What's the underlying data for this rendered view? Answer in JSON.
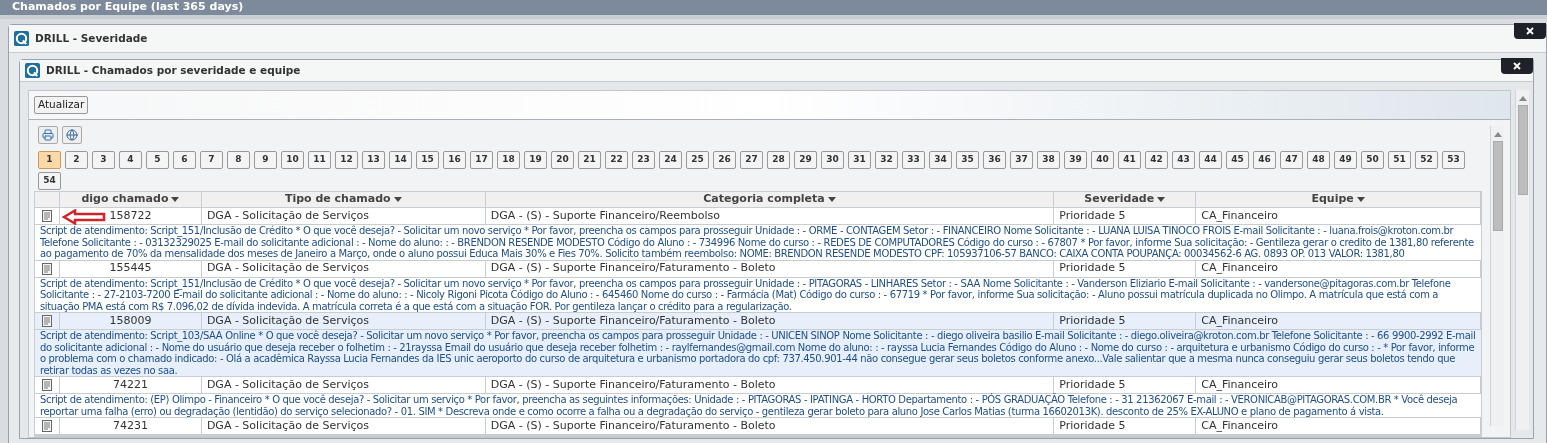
{
  "dashboard": {
    "title": "Chamados por Equipe (last 365 days)"
  },
  "drill_window": {
    "title": "DRILL - Severidade"
  },
  "inner_window": {
    "title": "DRILL - Chamados por severidade e equipe",
    "refresh_button": "Atualizar",
    "pages": [
      {
        "label": "1",
        "selected": true
      },
      {
        "label": "2",
        "selected": false
      },
      {
        "label": "3",
        "selected": false
      },
      {
        "label": "4",
        "selected": false
      },
      {
        "label": "5",
        "selected": false
      },
      {
        "label": "6",
        "selected": false
      },
      {
        "label": "7",
        "selected": false
      },
      {
        "label": "8",
        "selected": false
      },
      {
        "label": "9",
        "selected": false
      },
      {
        "label": "10",
        "selected": false
      },
      {
        "label": "11",
        "selected": false
      },
      {
        "label": "12",
        "selected": false
      },
      {
        "label": "13",
        "selected": false
      },
      {
        "label": "14",
        "selected": false
      },
      {
        "label": "15",
        "selected": false
      },
      {
        "label": "16",
        "selected": false
      },
      {
        "label": "17",
        "selected": false
      },
      {
        "label": "18",
        "selected": false
      },
      {
        "label": "19",
        "selected": false
      },
      {
        "label": "20",
        "selected": false
      },
      {
        "label": "21",
        "selected": false
      },
      {
        "label": "22",
        "selected": false
      },
      {
        "label": "23",
        "selected": false
      },
      {
        "label": "24",
        "selected": false
      },
      {
        "label": "25",
        "selected": false
      },
      {
        "label": "26",
        "selected": false
      },
      {
        "label": "27",
        "selected": false
      },
      {
        "label": "28",
        "selected": false
      },
      {
        "label": "29",
        "selected": false
      },
      {
        "label": "30",
        "selected": false
      },
      {
        "label": "31",
        "selected": false
      },
      {
        "label": "32",
        "selected": false
      },
      {
        "label": "33",
        "selected": false
      },
      {
        "label": "34",
        "selected": false
      },
      {
        "label": "35",
        "selected": false
      },
      {
        "label": "36",
        "selected": false
      },
      {
        "label": "37",
        "selected": false
      },
      {
        "label": "38",
        "selected": false
      },
      {
        "label": "39",
        "selected": false
      },
      {
        "label": "40",
        "selected": false
      },
      {
        "label": "41",
        "selected": false
      },
      {
        "label": "42",
        "selected": false
      },
      {
        "label": "43",
        "selected": false
      },
      {
        "label": "44",
        "selected": false
      },
      {
        "label": "45",
        "selected": false
      },
      {
        "label": "46",
        "selected": false
      },
      {
        "label": "47",
        "selected": false
      },
      {
        "label": "48",
        "selected": false
      },
      {
        "label": "49",
        "selected": false
      },
      {
        "label": "50",
        "selected": false
      },
      {
        "label": "51",
        "selected": false
      },
      {
        "label": "52",
        "selected": false
      },
      {
        "label": "53",
        "selected": false
      },
      {
        "label": "54",
        "selected": false
      }
    ],
    "table": {
      "columns": [
        "digo chamado",
        "Tipo de chamado",
        "Categoria completa",
        "Severidade",
        "Equipe"
      ],
      "rows": [
        {
          "code": "158722",
          "type": "DGA - Solicitação de Serviços",
          "category": "DGA - (S) - Suporte Financeiro/Reembolso",
          "severity": "Prioridade 5",
          "team": "CA_Financeiro",
          "selected": false,
          "description": "Script de atendimento: Script_151/Inclusão de Crédito * O que você deseja? - Solicitar um novo serviço * Por favor, preencha os campos para prosseguir Unidade : - ORME - CONTAGEM Setor : - FINANCEIRO Nome Solicitante : - LUANA LUISA TINOCO FROIS E-mail Solicitante : - luana.frois@kroton.com.br Telefone Solicitante : - 03132329025 E-mail do solicitante adicional : - Nome do aluno: : - BRENDON RESENDE MODESTO Código do Aluno : - 734996 Nome do curso : - REDES DE COMPUTADORES Código do curso : - 67807 * Por favor, informe Sua solicitação: - Gentileza gerar o credito de 1381,80 referente ao pagamento de 70% da mensalidade dos meses de Janeiro a Março, onde o aluno possui Educa Mais 30% e Fies 70%. Solicito também reembolso: NOME: BRENDON RESENDE MODESTO CPF: 105937106-57 BANCO: CAIXA CONTA POUPANÇA: 00034562-6 AG. 0893 OP. 013 VALOR: 1381,80"
        },
        {
          "code": "155445",
          "type": "DGA - Solicitação de Serviços",
          "category": "DGA - (S) - Suporte Financeiro/Faturamento - Boleto",
          "severity": "Prioridade 5",
          "team": "CA_Financeiro",
          "selected": false,
          "description": "Script de atendimento: Script_151/Inclusão de Crédito * O que você deseja? - Solicitar um novo serviço * Por favor, preencha os campos para prosseguir Unidade : - PITAGORAS - LINHARES Setor : - SAA Nome Solicitante : - Vanderson Eliziario E-mail Solicitante : - vandersone@pitagoras.com.br Telefone Solicitante : - 27-2103-7200 E-mail do solicitante adicional : - Nome do aluno: : - Nicoly Rigoni Picota Código do Aluno : - 645460 Nome do curso : - Farmácia (Mat) Código do curso : - 67719 * Por favor, informe Sua solicitação: - Aluno possui matrícula duplicada no Olimpo. A matrícula que está com a situação PMA está com R$ 7.096,02 de dívida indevida. A matrícula correta é a que está com a situação FOR. Por gentileza lançar o crédito para a regularização."
        },
        {
          "code": "158009",
          "type": "DGA - Solicitação de Serviços",
          "category": "DGA - (S) - Suporte Financeiro/Faturamento - Boleto",
          "severity": "Prioridade 5",
          "team": "CA_Financeiro",
          "selected": true,
          "description": "Script de atendimento: Script_103/SAA Online * O que você deseja? - Solicitar um novo serviço * Por favor, preencha os campos para prosseguir Unidade : - UNICEN SINOP Nome Solicitante : - diego oliveira basilio E-mail Solicitante : - diego.oliveira@kroton.com.br Telefone Solicitante : - 66 9900-2992 E-mail do solicitante adicional : - Nome do usuário que deseja receber o folhetim : - 21rayssa Email do usuário que deseja receber folhetim : - raylfernandes@gmail.com Nome do aluno: : - rayssa Lucia Fernandes Código do Aluno : - Nome do curso : - arquitetura e urbanismo Código do curso : - * Por favor, informe o problema com o chamado indicado: - Olá a acadêmica Rayssa Lucia Fernandes da IES unic aeroporto do curso de arquitetura e urbanismo portadora do cpf: 737.450.901-44 não consegue gerar seus boletos conforme anexo...Vale salientar que a mesma nunca conseguiu gerar seus boletos tendo que retirar todas as vezes no saa."
        },
        {
          "code": "74221",
          "type": "DGA - Solicitação de Serviços",
          "category": "DGA - (S) - Suporte Financeiro/Faturamento - Boleto",
          "severity": "Prioridade 5",
          "team": "CA_Financeiro",
          "selected": false,
          "description": "Script de atendimento: (EP) Olimpo - Financeiro * O que você deseja? - Solicitar um serviço * Por favor, preencha as seguintes informações: Unidade : - PITAGORAS - IPATINGA - HORTO Departamento : - PÓS GRADUAÇÃO Telefone : - 31 21362067 E-mail : - VERONICAB@PITAGORAS.COM.BR * Você deseja reportar uma falha (erro) ou degradação (lentidão) do serviço selecionado? - 01. SIM * Descreva onde e como ocorre a falha ou a degradação do serviço - gentileza gerar boleto para aluno Jose Carlos Matias (turma 16602013K). desconto de 25% EX-ALUNO e plano de pagamento á vista."
        },
        {
          "code": "74231",
          "type": "DGA - Solicitação de Serviços",
          "category": "DGA - (S) - Suporte Financeiro/Faturamento - Boleto",
          "severity": "Prioridade 5",
          "team": "CA_Financeiro",
          "selected": false
        }
      ]
    }
  }
}
